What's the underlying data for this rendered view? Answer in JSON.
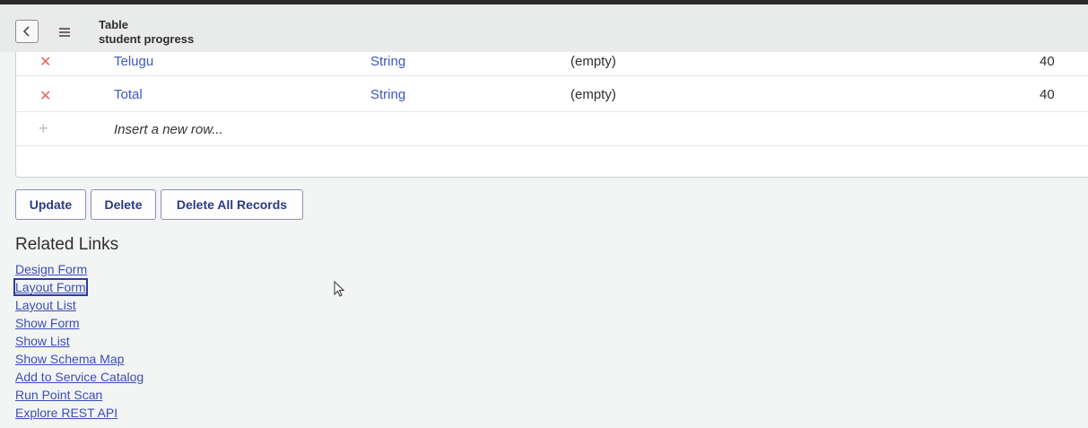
{
  "header": {
    "back_icon": "chevron-left-icon",
    "menu_icon": "hamburger-icon",
    "record_type": "Table",
    "record_name": "student progress"
  },
  "columns_table": {
    "rows": [
      {
        "column": "Telugu",
        "type": "String",
        "reference": "(empty)",
        "max_length": "40"
      },
      {
        "column": "Total",
        "type": "String",
        "reference": "(empty)",
        "max_length": "40"
      }
    ],
    "insert_label": "Insert a new row..."
  },
  "actions": {
    "update": "Update",
    "delete": "Delete",
    "delete_all": "Delete All Records"
  },
  "related": {
    "title": "Related Links",
    "links": [
      "Design Form",
      "Layout Form",
      "Layout List",
      "Show Form",
      "Show List",
      "Show Schema Map",
      "Add to Service Catalog",
      "Run Point Scan",
      "Explore REST API"
    ],
    "focused_link": "Layout Form"
  },
  "colors": {
    "link": "#3d55c4",
    "delete_x": "#e0685a",
    "button_text": "#2c3a86"
  }
}
